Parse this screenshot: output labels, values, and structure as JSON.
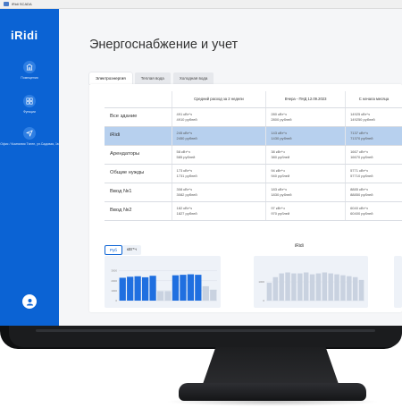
{
  "window": {
    "title": "iRidi SCADA"
  },
  "app": {
    "logo": "iRidi"
  },
  "sidebar": {
    "items": [
      {
        "label": "Помещения",
        "icon": "building-icon"
      },
      {
        "label": "Функции",
        "icon": "grid-icon"
      },
      {
        "label": "Офис / Компания Тэлен, ул.Садовая, 1в",
        "icon": "location-arrow-icon"
      }
    ],
    "profile_icon": "user-icon"
  },
  "page": {
    "title": "Энергоснабжение и учет"
  },
  "tabs": [
    {
      "label": "Электроэнергия",
      "active": true
    },
    {
      "label": "Теплая вода",
      "active": false
    },
    {
      "label": "Холодная вода",
      "active": false
    }
  ],
  "table": {
    "columns": [
      "",
      "Средний расход за 2 недели",
      "Вчера - ПНД 12.09.2023",
      "С начала месяца"
    ],
    "rows": [
      {
        "name": "Все здание",
        "cells": [
          [
            "491 кВт*ч",
            "4910 рублей"
          ],
          [
            "280 кВт*ч",
            "2800 рублей"
          ],
          [
            "14925 кВт*ч",
            "149250 рублей"
          ]
        ],
        "highlight": false
      },
      {
        "name": "iRidi",
        "cells": [
          [
            "245 кВт*ч",
            "2450 рублей"
          ],
          [
            "143 кВт*ч",
            "1430 рублей"
          ],
          [
            "7137 кВт*ч",
            "71370 рублей"
          ]
        ],
        "highlight": true
      },
      {
        "name": "Арендаторы",
        "cells": [
          [
            "58 кВт*ч",
            "585 рублей"
          ],
          [
            "38 кВт*ч",
            "380 рублей"
          ],
          [
            "1667 кВт*ч",
            "16670 рублей"
          ]
        ],
        "highlight": false
      },
      {
        "name": "Общие нужды",
        "cells": [
          [
            "173 кВт*ч",
            "1731 рублей"
          ],
          [
            "94 кВт*ч",
            "940 рублей"
          ],
          [
            "5771 кВт*ч",
            "57710 рублей"
          ]
        ],
        "highlight": false
      },
      {
        "name": "Ввод №1",
        "cells": [
          [
            "308 кВт*ч",
            "3082 рублей"
          ],
          [
            "183 кВт*ч",
            "1830 рублей"
          ],
          [
            "8885 кВт*ч",
            "88850 рублей"
          ]
        ],
        "highlight": false
      },
      {
        "name": "Ввод №2",
        "cells": [
          [
            "182 кВт*ч",
            "1827 рублей"
          ],
          [
            "97 кВт*ч",
            "970 рублей"
          ],
          [
            "6040 кВт*ч",
            "60400 рублей"
          ]
        ],
        "highlight": false
      }
    ]
  },
  "chart_toggle": {
    "options": [
      "Руб",
      "кВт*ч"
    ],
    "active": "Руб"
  },
  "chart2_title": "iRidi",
  "chart_data": [
    {
      "type": "bar",
      "title": "",
      "yticks": [
        0,
        1000,
        2000,
        3000
      ],
      "ylim": [
        0,
        3600
      ],
      "series": [
        {
          "values": [
            2300,
            2400,
            2450,
            2350,
            2500,
            950,
            950,
            2550,
            2600,
            2650,
            2600,
            1450,
            1100
          ],
          "colors": [
            "#1f6fe0",
            "#1f6fe0",
            "#1f6fe0",
            "#1f6fe0",
            "#1f6fe0",
            "#c9d2e0",
            "#c9d2e0",
            "#1f6fe0",
            "#1f6fe0",
            "#1f6fe0",
            "#1f6fe0",
            "#c9d2e0",
            "#c9d2e0"
          ]
        }
      ],
      "grid": true
    },
    {
      "type": "bar",
      "title": "iRidi",
      "yticks": [
        0,
        1000
      ],
      "ylim": [
        0,
        2000
      ],
      "series": [
        {
          "values": [
            950,
            1250,
            1450,
            1500,
            1450,
            1450,
            1500,
            1400,
            1450,
            1500,
            1450,
            1400,
            1350,
            1300,
            1250,
            1100
          ],
          "colors": [
            "#c9d2e0",
            "#c9d2e0",
            "#c9d2e0",
            "#c9d2e0",
            "#c9d2e0",
            "#c9d2e0",
            "#c9d2e0",
            "#c9d2e0",
            "#c9d2e0",
            "#c9d2e0",
            "#c9d2e0",
            "#c9d2e0",
            "#c9d2e0",
            "#c9d2e0",
            "#c9d2e0",
            "#c9d2e0"
          ]
        }
      ],
      "grid": true
    }
  ]
}
